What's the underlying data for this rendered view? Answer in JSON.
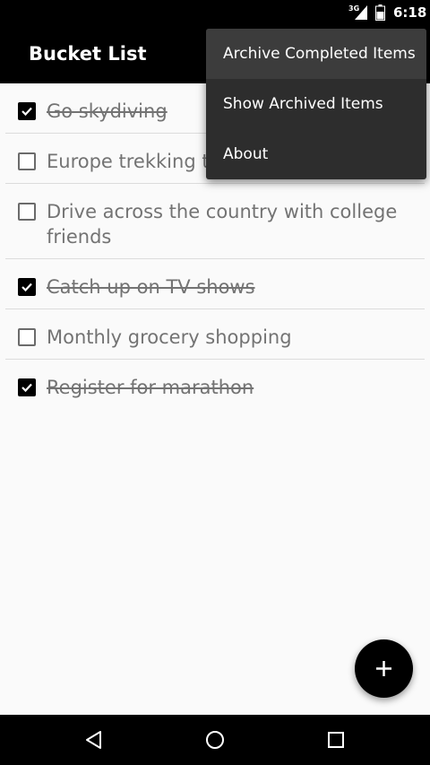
{
  "status_bar": {
    "network": "3G",
    "time": "6:18"
  },
  "app_bar": {
    "title": "Bucket List"
  },
  "items": [
    {
      "label": "Go skydiving",
      "checked": true
    },
    {
      "label": "Europe trekking trip",
      "checked": false
    },
    {
      "label": "Drive across the country with college friends",
      "checked": false
    },
    {
      "label": "Catch up on TV shows",
      "checked": true
    },
    {
      "label": "Monthly grocery shopping",
      "checked": false
    },
    {
      "label": "Register for marathon",
      "checked": true
    }
  ],
  "menu": {
    "items": [
      {
        "label": "Archive Completed Items"
      },
      {
        "label": "Show Archived Items"
      },
      {
        "label": "About"
      }
    ]
  },
  "fab": {
    "icon": "plus-icon"
  },
  "nav_bar": {
    "icons": [
      "back-icon",
      "home-icon",
      "recents-icon"
    ]
  },
  "colors": {
    "app_bar": "#000000",
    "background": "#fafafa",
    "menu": "#2d2d2d",
    "text_muted": "#737373"
  }
}
